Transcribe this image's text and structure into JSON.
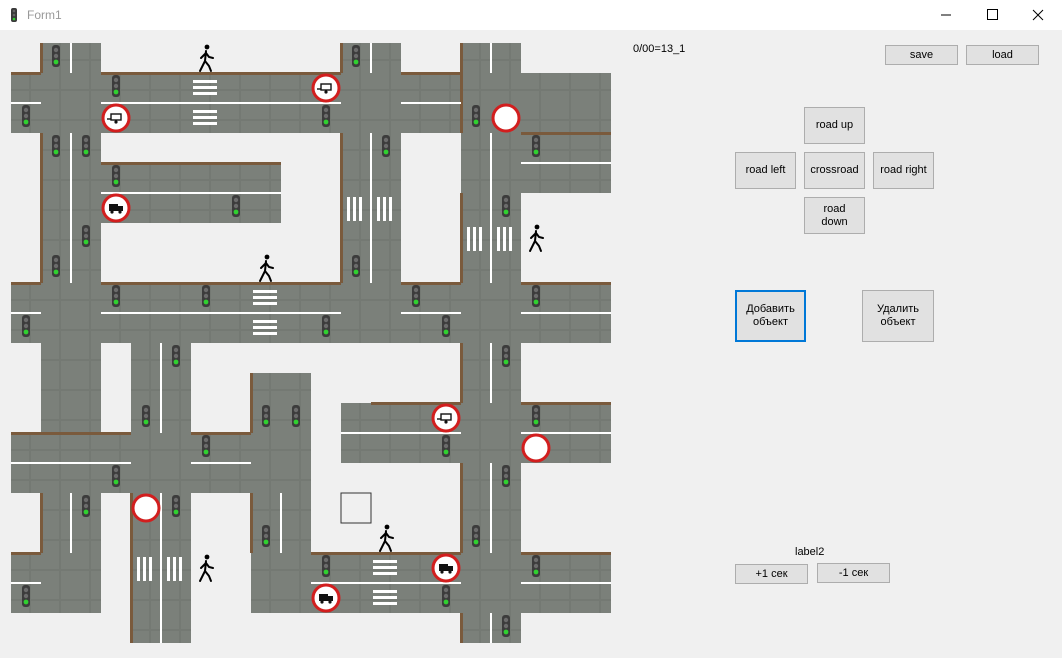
{
  "window": {
    "title": "Form1"
  },
  "status_text": "0/00=13_1",
  "file_buttons": {
    "save": "save",
    "load": "load"
  },
  "road_buttons": {
    "up": "road up",
    "left": "road left",
    "cross": "crossroad",
    "right": "road right",
    "down": "road\ndown"
  },
  "object_buttons": {
    "add": "Добавить\nобъект",
    "remove": "Удалить\nобъект"
  },
  "timer": {
    "label": "label2",
    "plus": "+1 сек",
    "minus": "-1 сек"
  },
  "colors": {
    "asphalt": "#7b807a",
    "curb": "#7a5a3c",
    "sign_red": "#d21e1e",
    "light_green": "#2fd12f",
    "focus": "#0078d7"
  }
}
